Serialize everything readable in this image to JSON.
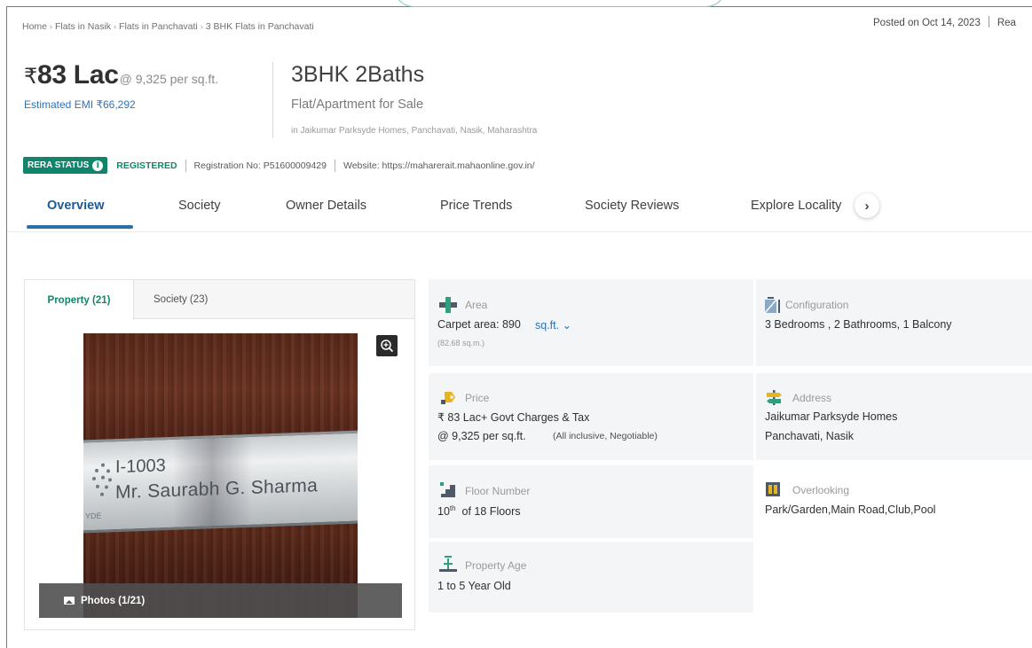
{
  "breadcrumb": [
    "Home",
    "Flats in Nasik",
    "Flats in Panchavati",
    "3 BHK Flats in Panchavati"
  ],
  "posted": {
    "text": "Posted on Oct 14, 2023",
    "next": "Rea"
  },
  "price": {
    "currency": "₹",
    "amount": "83 Lac",
    "per_sqft": "@ 9,325 per sq.ft.",
    "emi": "Estimated EMI ₹66,292"
  },
  "config": {
    "title": "3BHK 2Baths",
    "type": "Flat/Apartment for Sale",
    "location": "in Jaikumar Parksyde Homes, Panchavati, Nasik, Maharashtra"
  },
  "rera": {
    "label": "RERA STATUS",
    "status": "REGISTERED",
    "registration": "Registration No: P51600009429",
    "website": "Website: https://maharerait.mahaonline.gov.in/"
  },
  "tabs": [
    "Overview",
    "Society",
    "Owner Details",
    "Price Trends",
    "Society Reviews",
    "Explore Locality"
  ],
  "gallery": {
    "tab_property": "Property (21)",
    "tab_society": "Society (23)",
    "photos_label": "Photos (1/21)",
    "plate_line1": "I-1003",
    "plate_line2": "Mr. Saurabh G. Sharma",
    "plate_mark": "YDE"
  },
  "details": {
    "area": {
      "label": "Area",
      "value": "Carpet area: 890",
      "unit": "sq.ft.",
      "note": "(82.68 sq.m.)"
    },
    "configuration": {
      "label": "Configuration",
      "value": "3 Bedrooms , 2 Bathrooms, 1 Balcony"
    },
    "price": {
      "label": "Price",
      "value": "₹ 83 Lac+ Govt Charges & Tax",
      "value2": "@ 9,325 per sq.ft.",
      "note": "(All inclusive, Negotiable)"
    },
    "address": {
      "label": "Address",
      "line1": "Jaikumar Parksyde Homes",
      "line2": "Panchavati, Nasik"
    },
    "floor": {
      "label": "Floor Number",
      "value_num": "10",
      "value_sup": "th",
      "value_rest": "of 18 Floors"
    },
    "overlooking": {
      "label": "Overlooking",
      "value": "Park/Garden,Main Road,Club,Pool"
    },
    "age": {
      "label": "Property Age",
      "value": "1 to 5 Year Old"
    }
  },
  "colors": {
    "brand_green": "#11856c",
    "link_blue": "#2d74b6",
    "tab_blue": "#1c5c96"
  }
}
